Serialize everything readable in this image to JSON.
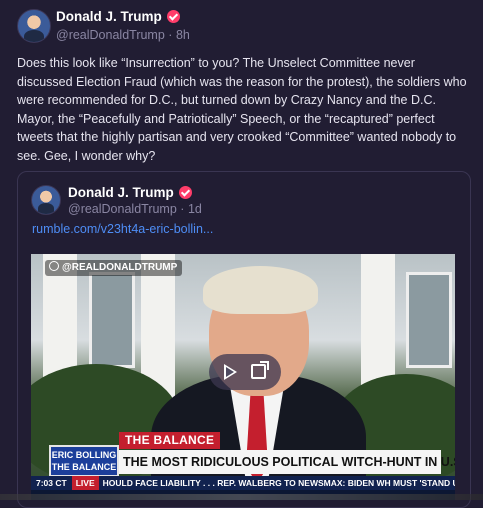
{
  "post": {
    "author": "Donald J. Trump",
    "handle": "@realDonaldTrump",
    "separator": "·",
    "time": "8h",
    "text": "Does this look like “Insurrection” to you? The Unselect Committee never discussed Election Fraud (which was the reason for the protest), the soldiers who were recommended for D.C., but turned down by Crazy Nancy and the D.C. Mayor, the “Peacefully and Patriotically” Speech, or the “recaptured” perfect tweets that the highly partisan and very crooked “Committee” wanted nobody to see. Gee, I wonder why?"
  },
  "quoted": {
    "author": "Donald J. Trump",
    "handle": "@realDonaldTrump",
    "separator": "·",
    "time": "1d",
    "link": "rumble.com/v23ht4a-eric-bollin..."
  },
  "video": {
    "watermark": "@REALDONALDTRUMP",
    "lower_third_tag": "THE BALANCE",
    "headline": "THE MOST RIDICULOUS  POLITICAL WITCH-HUNT IN U.S. HISTORY",
    "logo_text": "ERIC BOLLING THE BALANCE",
    "ticker_time": "7:03 CT",
    "ticker_live": "LIVE",
    "ticker_text": "HOULD FACE LIABILITY . . .      REP. WALBERG TO NEWSMAX: BIDEN WH MUST 'STAND U"
  },
  "icons": {
    "verified": "verified-badge-icon",
    "play": "play-icon",
    "share": "external-link-icon"
  },
  "colors": {
    "background": "#211d33",
    "link": "#4e8df5",
    "verified": "#ff3d6a"
  }
}
